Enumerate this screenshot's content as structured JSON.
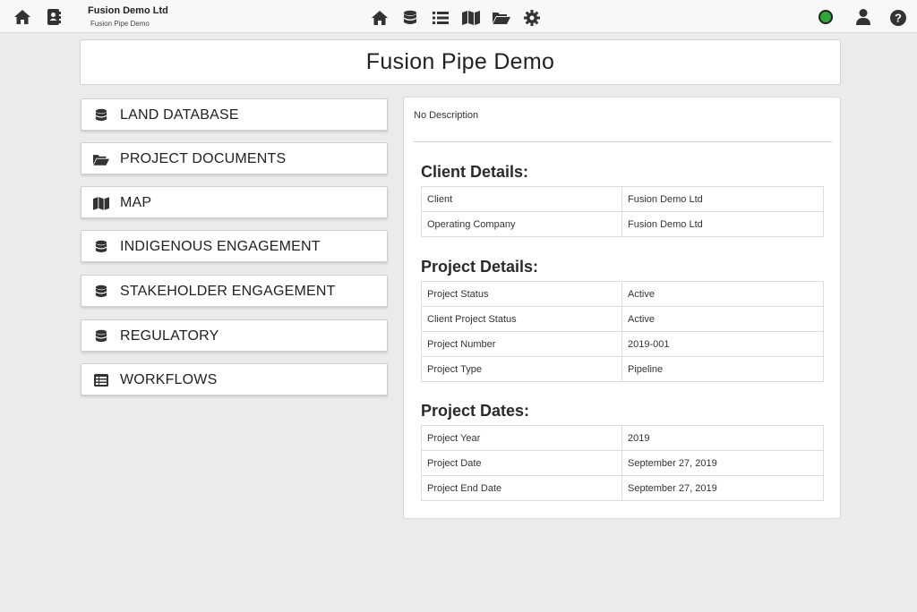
{
  "topbar": {
    "org_name": "Fusion Demo Ltd",
    "project_name": "Fusion Pipe Demo",
    "left_icons": [
      "home-icon",
      "contact-book-icon"
    ],
    "center_icons": [
      "home-icon",
      "database-icon",
      "list-icon",
      "map-icon",
      "folder-open-icon",
      "gear-icon"
    ],
    "right_icons": [
      "status-online-indicator",
      "user-icon",
      "help-icon"
    ],
    "status_color": "#2fa83a"
  },
  "header": {
    "title": "Fusion Pipe Demo"
  },
  "nav": {
    "items": [
      {
        "label": "LAND DATABASE",
        "icon": "database-icon"
      },
      {
        "label": "PROJECT DOCUMENTS",
        "icon": "folder-open-icon"
      },
      {
        "label": "MAP",
        "icon": "map-icon"
      },
      {
        "label": "INDIGENOUS ENGAGEMENT",
        "icon": "database-icon"
      },
      {
        "label": "STAKEHOLDER ENGAGEMENT",
        "icon": "database-icon"
      },
      {
        "label": "REGULATORY",
        "icon": "database-icon"
      },
      {
        "label": "WORKFLOWS",
        "icon": "table-icon"
      }
    ]
  },
  "details": {
    "description": "No Description",
    "client": {
      "title": "Client Details:",
      "rows": [
        {
          "label": "Client",
          "value": "Fusion Demo Ltd"
        },
        {
          "label": "Operating Company",
          "value": "Fusion Demo Ltd"
        }
      ]
    },
    "project": {
      "title": "Project Details:",
      "rows": [
        {
          "label": "Project Status",
          "value": "Active"
        },
        {
          "label": "Client Project Status",
          "value": "Active"
        },
        {
          "label": "Project Number",
          "value": "2019-001"
        },
        {
          "label": "Project Type",
          "value": "Pipeline"
        }
      ]
    },
    "dates": {
      "title": "Project Dates:",
      "rows": [
        {
          "label": "Project Year",
          "value": "2019"
        },
        {
          "label": "Project Date",
          "value": "September 27, 2019"
        },
        {
          "label": "Project End Date",
          "value": "September 27, 2019"
        }
      ]
    }
  }
}
